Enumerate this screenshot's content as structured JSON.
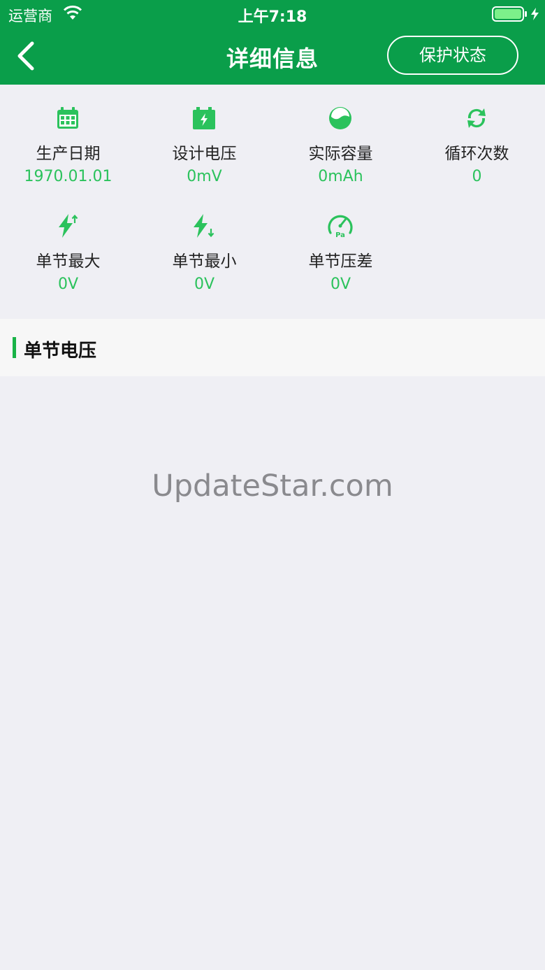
{
  "status_bar": {
    "carrier": "运营商",
    "time": "上午7:18",
    "wifi_icon": "wifi-icon",
    "battery_icon": "battery-charging-icon"
  },
  "nav": {
    "title": "详细信息",
    "back_icon": "chevron-left-icon",
    "protect_button_label": "保护状态"
  },
  "info_items": [
    {
      "icon": "calendar-icon",
      "label": "生产日期",
      "value": "1970.01.01"
    },
    {
      "icon": "battery-bolt-icon",
      "label": "设计电压",
      "value": "0mV"
    },
    {
      "icon": "capacity-gauge-icon",
      "label": "实际容量",
      "value": "0mAh"
    },
    {
      "icon": "cycle-refresh-icon",
      "label": "循环次数",
      "value": "0"
    },
    {
      "icon": "bolt-up-icon",
      "label": "单节最大",
      "value": "0V"
    },
    {
      "icon": "bolt-down-icon",
      "label": "单节最小",
      "value": "0V"
    },
    {
      "icon": "pressure-gauge-icon",
      "label": "单节压差",
      "value": "0V"
    }
  ],
  "section": {
    "title": "单节电压"
  },
  "watermark": "UpdateStar.com",
  "colors": {
    "header_green": "#0a9e4a",
    "accent_green": "#2bc25c",
    "background": "#efeff4"
  }
}
